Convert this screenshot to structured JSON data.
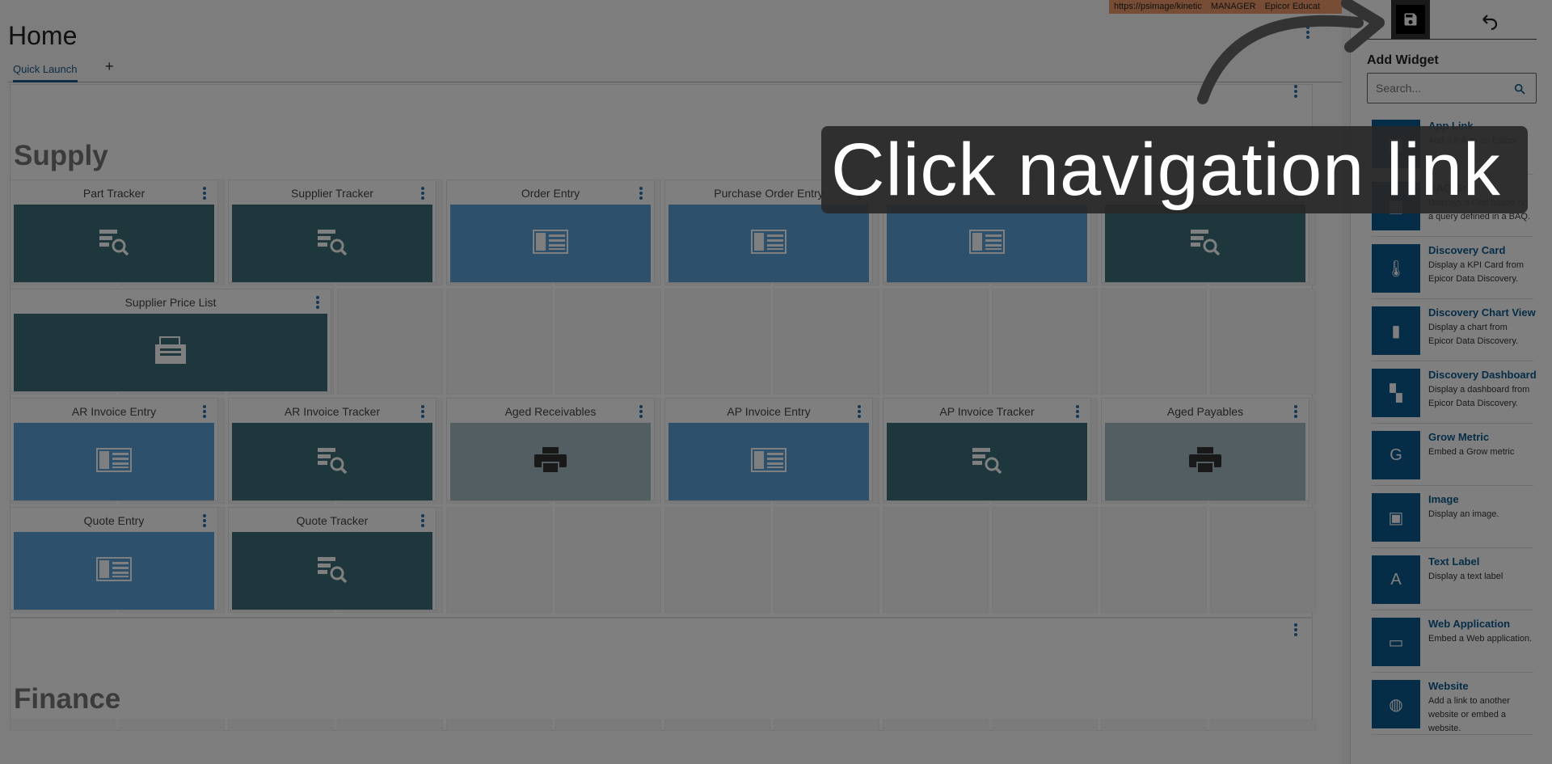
{
  "header": {
    "title": "Home",
    "env": [
      "https://psimage/kinetic",
      "MANAGER",
      "Epicor Educat"
    ]
  },
  "tabs": [
    {
      "label": "Quick Launch"
    },
    {
      "label": "+"
    }
  ],
  "panels": {
    "supply": {
      "title": "Supply"
    },
    "finance": {
      "title": "Finance"
    }
  },
  "tiles": [
    {
      "title": "Part Tracker",
      "style": "dark",
      "icon": "tracker-icon"
    },
    {
      "title": "Supplier Tracker",
      "style": "dark",
      "icon": "tracker-icon"
    },
    {
      "title": "Order Entry",
      "style": "light",
      "icon": "entry-form-icon"
    },
    {
      "title": "Purchase Order Entry",
      "style": "light",
      "icon": "entry-form-icon"
    },
    {
      "title": "",
      "style": "light",
      "icon": "entry-form-icon"
    },
    {
      "title": "",
      "style": "dark",
      "icon": "tracker-icon"
    },
    {
      "title": "Supplier Price List",
      "style": "dark",
      "icon": "report-icon"
    },
    {
      "title": "AR Invoice Entry",
      "style": "light",
      "icon": "entry-form-icon"
    },
    {
      "title": "AR Invoice Tracker",
      "style": "dark",
      "icon": "tracker-icon"
    },
    {
      "title": "Aged Receivables",
      "style": "grey",
      "icon": "printer-icon"
    },
    {
      "title": "AP Invoice Entry",
      "style": "light",
      "icon": "entry-form-icon"
    },
    {
      "title": "AP Invoice Tracker",
      "style": "dark",
      "icon": "tracker-icon"
    },
    {
      "title": "Aged Payables",
      "style": "grey",
      "icon": "printer-icon"
    },
    {
      "title": "Quote Entry",
      "style": "light",
      "icon": "entry-form-icon"
    },
    {
      "title": "Quote Tracker",
      "style": "dark",
      "icon": "tracker-icon"
    }
  ],
  "side": {
    "title": "Add Widget",
    "search_placeholder": "Search...",
    "widgets": [
      {
        "name": "App Link",
        "desc": "Add a link to an Epicor",
        "icon": "app-link-icon"
      },
      {
        "name": "BAQ Grid",
        "desc": "Displays a Grid based on a query defined in a BAQ.",
        "icon": "grid-icon"
      },
      {
        "name": "Discovery Card",
        "desc": "Display a KPI Card from Epicor Data Discovery.",
        "icon": "thermometer-icon"
      },
      {
        "name": "Discovery Chart View",
        "desc": "Display a chart from Epicor Data Discovery.",
        "icon": "bar-chart-icon"
      },
      {
        "name": "Discovery Dashboard",
        "desc": "Display a dashboard from Epicor Data Discovery.",
        "icon": "dashboard-icon"
      },
      {
        "name": "Grow Metric",
        "desc": "Embed a Grow metric",
        "icon": "grow-icon"
      },
      {
        "name": "Image",
        "desc": "Display an image.",
        "icon": "image-icon"
      },
      {
        "name": "Text Label",
        "desc": "Display a text label",
        "icon": "text-icon"
      },
      {
        "name": "Web Application",
        "desc": "Embed a Web application.",
        "icon": "web-app-icon"
      },
      {
        "name": "Website",
        "desc": "Add a link to another website or embed a website.",
        "icon": "globe-icon"
      }
    ]
  },
  "overlay": {
    "instruction": "Click navigation link"
  },
  "colors": {
    "light_tile": "#5aa3d8",
    "dark_tile": "#3a6e78",
    "grey_tile": "#a7bcc7",
    "accent": "#0a5a8f"
  }
}
